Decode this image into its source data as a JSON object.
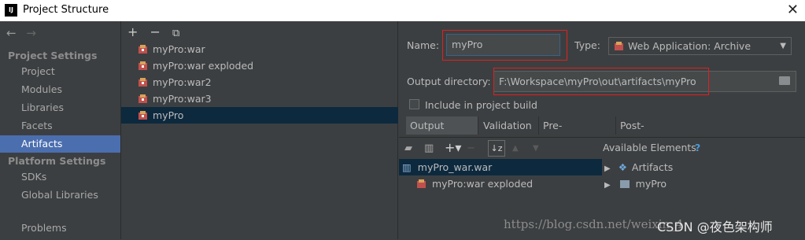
{
  "window": {
    "title": "Project Structure",
    "logo_text": "IJ"
  },
  "sidebar": {
    "nav_back": "←",
    "nav_forward": "→",
    "project_settings_title": "Project Settings",
    "project_items": [
      "Project",
      "Modules",
      "Libraries",
      "Facets",
      "Artifacts"
    ],
    "platform_settings_title": "Platform Settings",
    "platform_items": [
      "SDKs",
      "Global Libraries"
    ],
    "problems": "Problems",
    "selected": "Artifacts"
  },
  "artifacts_toolbar": {
    "add": "+",
    "remove": "−",
    "copy": "⧉"
  },
  "artifacts": [
    "myPro:war",
    "myPro:war exploded",
    "myPro:war2",
    "myPro:war3",
    "myPro"
  ],
  "selected_artifact": "myPro",
  "form": {
    "name_label": "Name:",
    "name_value": "myPro",
    "type_label": "Type:",
    "type_value": "Web Application: Archive",
    "output_label": "Output directory:",
    "output_value": "F:\\Workspace\\myPro\\out\\artifacts\\myPro",
    "include_label": "Include in project build",
    "include_checked": false
  },
  "tabs": [
    "Output Layout",
    "Validation",
    "Pre-processing",
    "Post-processing"
  ],
  "active_tab": "Output Layout",
  "layout": {
    "available_label": "Available Elements",
    "help": "?",
    "left_tree": [
      "myPro_war.war",
      "myPro:war exploded"
    ],
    "right_tree": [
      "Artifacts",
      "myPro"
    ]
  },
  "watermark": {
    "url": "https://blog.csdn.net/weixin_4",
    "brand": "CSDN @夜色架构师"
  }
}
